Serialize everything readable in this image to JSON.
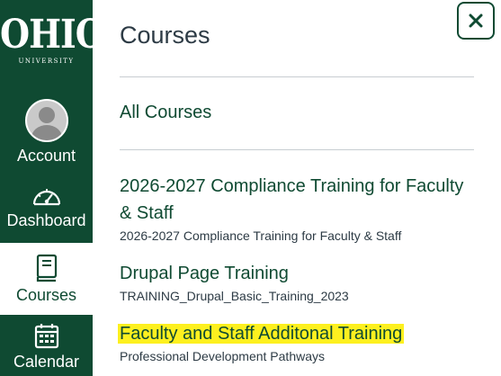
{
  "global_nav": {
    "logo": {
      "main": "OHIO",
      "sub": "UNIVERSITY"
    },
    "items": [
      {
        "label": "Account",
        "icon": "avatar-icon"
      },
      {
        "label": "Dashboard",
        "icon": "speedometer-icon"
      },
      {
        "label": "Courses",
        "icon": "book-icon",
        "active": true
      },
      {
        "label": "Calendar",
        "icon": "calendar-icon"
      }
    ],
    "colors": {
      "brand": "#0f4a32",
      "active_bg": "#ffffff"
    }
  },
  "tray": {
    "title": "Courses",
    "close_icon": "close-icon",
    "all_courses_label": "All Courses",
    "courses": [
      {
        "name": "2026-2027 Compliance Training for Faculty & Staff",
        "term": "2026-2027 Compliance Training for Faculty & Staff"
      },
      {
        "name": "Drupal Page Training",
        "term": "TRAINING_Drupal_Basic_Training_2023"
      },
      {
        "name": "Faculty and Staff Additonal Training",
        "term": "Professional Development Pathways",
        "highlighted": true
      }
    ],
    "colors": {
      "link": "#0f4a32",
      "text": "#2d3b45",
      "highlight": "#fdf01f"
    }
  }
}
